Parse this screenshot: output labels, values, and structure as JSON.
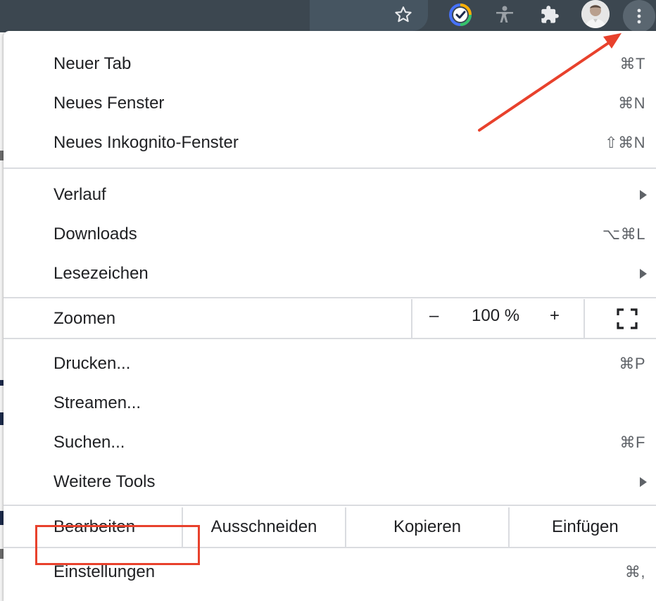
{
  "toolbar": {
    "icons": [
      "star-icon",
      "ticktick-icon",
      "accessibility-icon",
      "extensions-icon",
      "avatar",
      "more-icon"
    ]
  },
  "menu": {
    "group1": [
      {
        "label": "Neuer Tab",
        "shortcut": "⌘T"
      },
      {
        "label": "Neues Fenster",
        "shortcut": "⌘N"
      },
      {
        "label": "Neues Inkognito-Fenster",
        "shortcut": "⇧⌘N"
      }
    ],
    "group2": [
      {
        "label": "Verlauf",
        "shortcut": ""
      },
      {
        "label": "Downloads",
        "shortcut": "⌥⌘L"
      },
      {
        "label": "Lesezeichen",
        "shortcut": ""
      }
    ],
    "zoom": {
      "label": "Zoomen",
      "minus": "–",
      "value": "100 %",
      "plus": "+"
    },
    "group3": [
      {
        "label": "Drucken...",
        "shortcut": "⌘P"
      },
      {
        "label": "Streamen...",
        "shortcut": ""
      },
      {
        "label": "Suchen...",
        "shortcut": "⌘F"
      },
      {
        "label": "Weitere Tools",
        "shortcut": ""
      }
    ],
    "edit": {
      "label": "Bearbeiten",
      "cut": "Ausschneiden",
      "copy": "Kopieren",
      "paste": "Einfügen"
    },
    "settings": {
      "label": "Einstellungen",
      "shortcut": "⌘,"
    }
  },
  "colors": {
    "toolbar": "#3c4750",
    "highlight": "#e8412c",
    "arrow": "#e8412c"
  }
}
